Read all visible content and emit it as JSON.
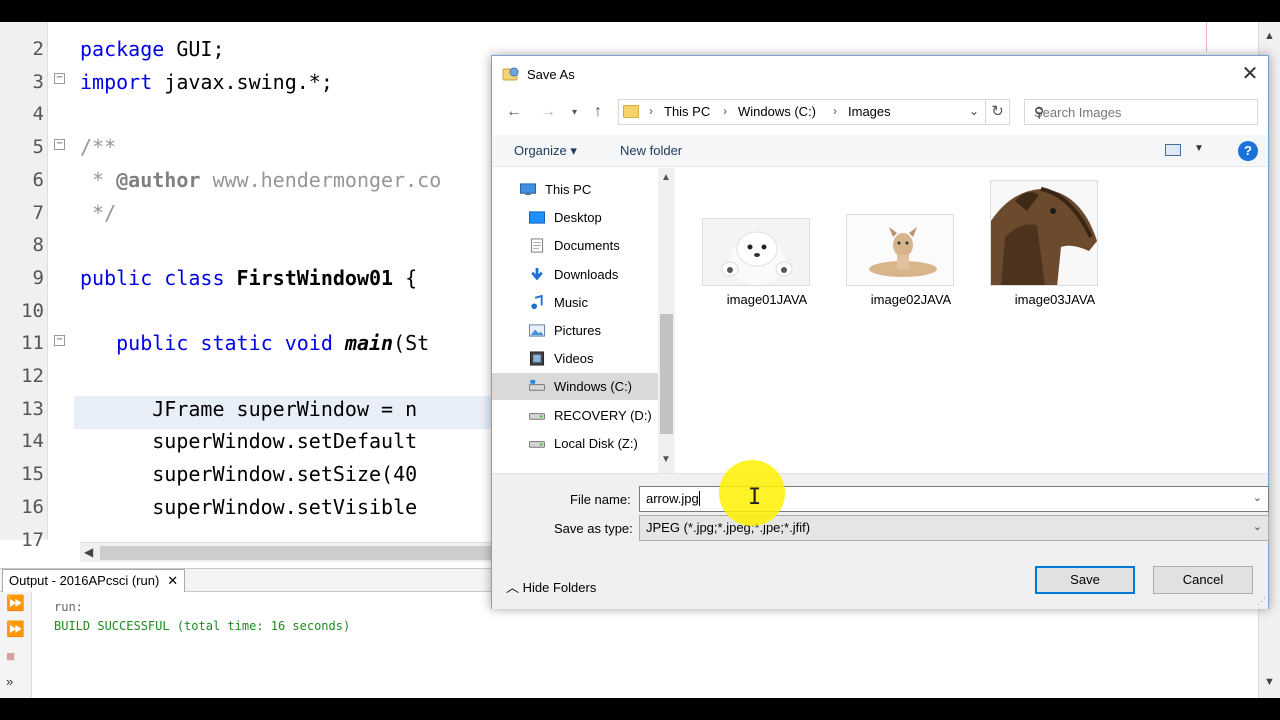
{
  "editor": {
    "line_numbers": [
      "2",
      "3",
      "4",
      "5",
      "6",
      "7",
      "8",
      "9",
      "10",
      "11",
      "12",
      "13",
      "14",
      "15",
      "16",
      "17"
    ],
    "lines": [
      {
        "kw": "package",
        "rest": " GUI;"
      },
      {
        "kw": "import",
        "rest": " javax.swing.*;"
      },
      {
        "text": ""
      },
      {
        "comment": "/**"
      },
      {
        "comment_pre": " * ",
        "tag": "@author",
        "comment_post": " www.hendermonger.co"
      },
      {
        "comment": " */"
      },
      {
        "text": ""
      },
      {
        "kw": "public class",
        "bold": "FirstWindow01",
        "rest": " {"
      },
      {
        "text": ""
      },
      {
        "indent": "   ",
        "kw": "public static void",
        "ital": "main",
        "rest": "(St"
      },
      {
        "text": ""
      },
      {
        "indent": "      ",
        "rest": "JFrame superWindow = n"
      },
      {
        "indent": "      ",
        "rest": "superWindow.setDefault"
      },
      {
        "indent": "      ",
        "rest": "superWindow.setSize(40"
      },
      {
        "indent": "      ",
        "rest": "superWindow.setVisible"
      }
    ]
  },
  "output": {
    "tab_label": "Output - 2016APcsci (run)",
    "close_label": "✕",
    "lines": [
      "run:",
      "BUILD SUCCESSFUL (total time: 16 seconds)"
    ]
  },
  "dialog": {
    "title": "Save As",
    "close_glyph": "✕",
    "breadcrumb": [
      "This PC",
      "Windows (C:)",
      "Images"
    ],
    "search_placeholder": "Search Images",
    "organize_label": "Organize ▾",
    "new_folder_label": "New folder",
    "help_glyph": "?",
    "tree": [
      {
        "label": "This PC",
        "icon": "pc-icon",
        "level": 0
      },
      {
        "label": "Desktop",
        "icon": "desktop-icon",
        "level": 1
      },
      {
        "label": "Documents",
        "icon": "documents-icon",
        "level": 1
      },
      {
        "label": "Downloads",
        "icon": "downloads-icon",
        "level": 1
      },
      {
        "label": "Music",
        "icon": "music-icon",
        "level": 1
      },
      {
        "label": "Pictures",
        "icon": "pictures-icon",
        "level": 1
      },
      {
        "label": "Videos",
        "icon": "videos-icon",
        "level": 1
      },
      {
        "label": "Windows (C:)",
        "icon": "drive-icon",
        "level": 1,
        "selected": true
      },
      {
        "label": "RECOVERY (D:)",
        "icon": "drive-icon",
        "level": 1
      },
      {
        "label": "Local Disk (Z:)",
        "icon": "drive-icon",
        "level": 1
      }
    ],
    "files": [
      {
        "name": "image01JAVA",
        "thumb": "white-puppy"
      },
      {
        "name": "image02JAVA",
        "thumb": "lying-dog"
      },
      {
        "name": "image03JAVA",
        "thumb": "brindle-greyhound"
      }
    ],
    "file_name_label": "File name:",
    "file_name_value": "arrow.jpg",
    "save_type_label": "Save as type:",
    "save_type_value": "JPEG (*.jpg;*.jpeg;*.jpe;*.jfif)",
    "hide_folders_label": "Hide Folders",
    "save_label": "Save",
    "cancel_label": "Cancel"
  },
  "colors": {
    "keyword": "#0000e6",
    "comment": "#969696",
    "build_success": "#1e8c1e",
    "accent": "#0078d7",
    "cursor_highlight": "#fff000"
  }
}
